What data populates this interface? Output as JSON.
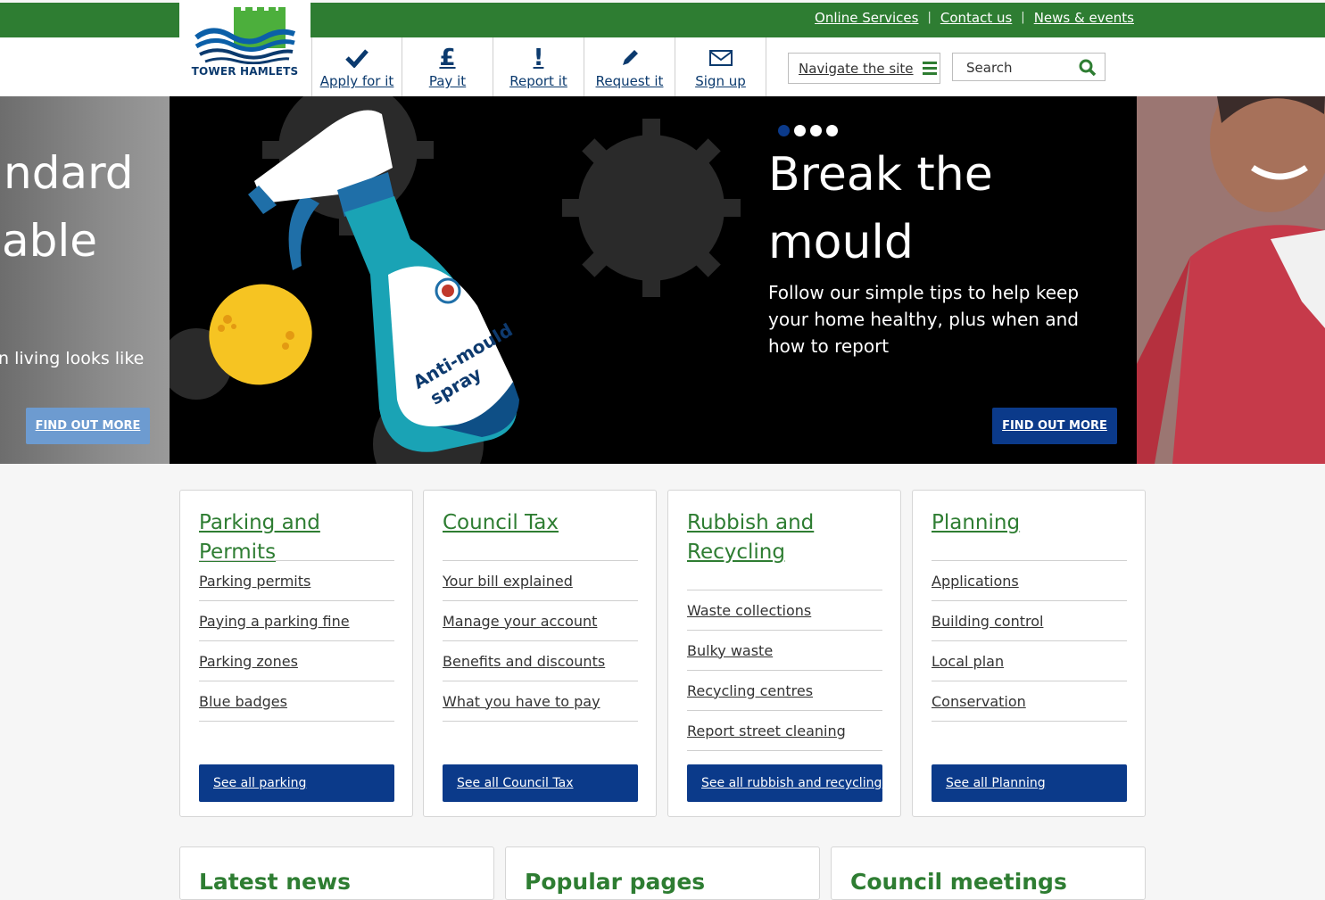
{
  "top_links": [
    "Online Services",
    "Contact us",
    "News & events"
  ],
  "logo": {
    "text": "TOWER HAMLETS"
  },
  "quick_nav": [
    {
      "label": "Apply for it",
      "icon": "checkmark-icon"
    },
    {
      "label": "Pay it",
      "icon": "pound-icon"
    },
    {
      "label": "Report it",
      "icon": "exclamation-icon"
    },
    {
      "label": "Request it",
      "icon": "pencil-icon"
    },
    {
      "label": "Sign up",
      "icon": "envelope-icon"
    }
  ],
  "navigate": {
    "label": "Navigate the site"
  },
  "search": {
    "placeholder": "Search"
  },
  "carousel": {
    "prev_slide": {
      "line1": "ndard",
      "line2": "able",
      "text": "n living looks like",
      "button": "FIND OUT MORE"
    },
    "current_slide": {
      "title": "Break the mould",
      "text": "Follow our simple tips to help keep your home healthy, plus when and how to report",
      "button": "FIND OUT MORE",
      "bottle_label_line1": "Anti-mould",
      "bottle_label_line2": "spray"
    },
    "dots_total": 4,
    "active_dot": 0
  },
  "cards": [
    {
      "title": "Parking and Permits",
      "links": [
        "Parking permits",
        "Paying a parking fine",
        "Parking zones",
        "Blue badges"
      ],
      "button": "See all parking"
    },
    {
      "title": "Council Tax",
      "links": [
        "Your bill explained",
        "Manage your account",
        "Benefits and discounts",
        "What you have to pay"
      ],
      "button": "See all Council Tax"
    },
    {
      "title": "Rubbish and Recycling",
      "links": [
        "Waste collections",
        "Bulky waste",
        "Recycling centres",
        "Report street cleaning"
      ],
      "button": "See all rubbish and recycling"
    },
    {
      "title": "Planning",
      "links": [
        "Applications",
        "Building control",
        "Local plan",
        "Conservation"
      ],
      "button": "See all Planning"
    }
  ],
  "panels": [
    "Latest news",
    "Popular pages",
    "Council meetings"
  ],
  "colors": {
    "brand_green": "#2e7d32",
    "brand_blue": "#0b3a8a",
    "link_blue": "#0b3a6e"
  }
}
